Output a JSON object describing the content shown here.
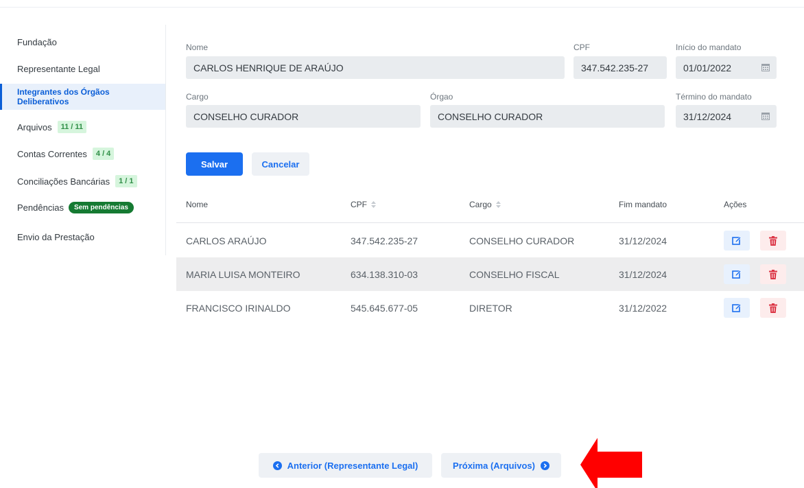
{
  "sidebar": {
    "items": [
      {
        "label": "Fundação"
      },
      {
        "label": "Representante Legal"
      },
      {
        "label": "Integrantes dos Órgãos Deliberativos"
      },
      {
        "label": "Arquivos",
        "badge": "11 / 11"
      },
      {
        "label": "Contas Correntes",
        "badge": "4 / 4"
      },
      {
        "label": "Conciliações Bancárias",
        "badge": "1 / 1"
      },
      {
        "label": "Pendências",
        "badge": "Sem pendências"
      },
      {
        "label": "Envio da Prestação"
      }
    ]
  },
  "form": {
    "nome_label": "Nome",
    "nome_value": "CARLOS HENRIQUE DE ARAÚJO",
    "cpf_label": "CPF",
    "cpf_value": "347.542.235-27",
    "inicio_label": "Início do mandato",
    "inicio_value": "01/01/2022",
    "cargo_label": "Cargo",
    "cargo_value": "CONSELHO CURADOR",
    "orgao_label": "Órgao",
    "orgao_value": "CONSELHO CURADOR",
    "termino_label": "Término do mandato",
    "termino_value": "31/12/2024",
    "save_label": "Salvar",
    "cancel_label": "Cancelar"
  },
  "table": {
    "headers": {
      "nome": "Nome",
      "cpf": "CPF",
      "cargo": "Cargo",
      "fim": "Fim mandato",
      "acoes": "Ações"
    },
    "rows": [
      {
        "nome": "CARLOS ARAÚJO",
        "cpf": "347.542.235-27",
        "cargo": "CONSELHO CURADOR",
        "fim": "31/12/2024"
      },
      {
        "nome": "MARIA LUISA MONTEIRO",
        "cpf": "634.138.310-03",
        "cargo": "CONSELHO FISCAL",
        "fim": "31/12/2024"
      },
      {
        "nome": "FRANCISCO IRINALDO",
        "cpf": "545.645.677-05",
        "cargo": "DIRETOR",
        "fim": "31/12/2022"
      }
    ]
  },
  "nav": {
    "prev_label": "Anterior (Representante Legal)",
    "next_label": "Próxima (Arquivos)"
  },
  "colors": {
    "primary": "#1b6ff0",
    "active_sidebar_bg": "#e8f0fb",
    "badge_green_bg": "#d6f5dd",
    "pill_green": "#157a32",
    "delete_red": "#dc3545",
    "annotation_arrow": "#ff0000"
  },
  "icons": {
    "calendar": "calendar-icon",
    "sort": "sort-icon",
    "edit": "edit-icon",
    "delete": "trash-icon",
    "prev": "chevron-left-circle-icon",
    "next": "chevron-right-circle-icon"
  }
}
